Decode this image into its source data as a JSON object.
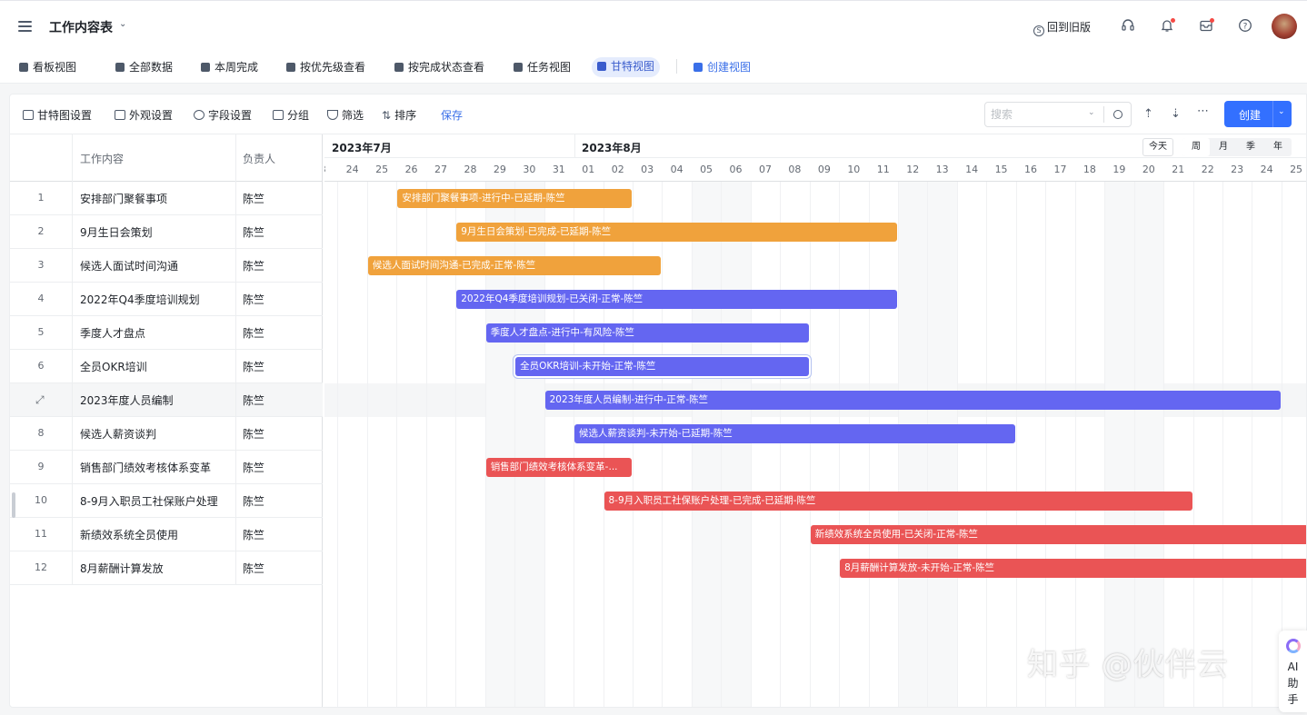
{
  "app": {
    "title": "工作内容表",
    "old_version": "回到旧版"
  },
  "views": [
    {
      "label": "看板视图"
    },
    {
      "label": "全部数据"
    },
    {
      "label": "本周完成"
    },
    {
      "label": "按优先级查看"
    },
    {
      "label": "按完成状态查看"
    },
    {
      "label": "任务视图"
    },
    {
      "label": "甘特视图",
      "active": true
    },
    {
      "label": "创建视图"
    }
  ],
  "toolbar": {
    "gantt_settings": "甘特图设置",
    "appearance": "外观设置",
    "fields": "字段设置",
    "group": "分组",
    "filter": "筛选",
    "sort": "排序",
    "save": "保存",
    "search_placeholder": "搜索",
    "create": "创建"
  },
  "table": {
    "col_task": "工作内容",
    "col_owner": "负责人",
    "rows": [
      {
        "no": "1",
        "task": "安排部门聚餐事项",
        "owner": "陈竺"
      },
      {
        "no": "2",
        "task": "9月生日会策划",
        "owner": "陈竺"
      },
      {
        "no": "3",
        "task": "候选人面试时间沟通",
        "owner": "陈竺"
      },
      {
        "no": "4",
        "task": "2022年Q4季度培训规划",
        "owner": "陈竺"
      },
      {
        "no": "5",
        "task": "季度人才盘点",
        "owner": "陈竺"
      },
      {
        "no": "6",
        "task": "全员OKR培训",
        "owner": "陈竺"
      },
      {
        "no": "",
        "task": "2023年度人员编制",
        "owner": "陈竺"
      },
      {
        "no": "8",
        "task": "候选人薪资谈判",
        "owner": "陈竺"
      },
      {
        "no": "9",
        "task": "销售部门绩效考核体系变革",
        "owner": "陈竺"
      },
      {
        "no": "10",
        "task": "8-9月入职员工社保账户处理",
        "owner": "陈竺"
      },
      {
        "no": "11",
        "task": "新绩效系统全员使用",
        "owner": "陈竺"
      },
      {
        "no": "12",
        "task": "8月薪酬计算发放",
        "owner": "陈竺"
      }
    ]
  },
  "gantt": {
    "months": [
      {
        "label": "2023年7月"
      },
      {
        "label": "2023年8月"
      }
    ],
    "days": [
      "3",
      "24",
      "25",
      "26",
      "27",
      "28",
      "29",
      "30",
      "31",
      "01",
      "02",
      "03",
      "04",
      "05",
      "06",
      "07",
      "08",
      "09",
      "10",
      "11",
      "12",
      "13",
      "14",
      "15",
      "16",
      "17",
      "18",
      "19",
      "20",
      "21",
      "22",
      "23",
      "24",
      "25"
    ],
    "today": "今天",
    "scales": [
      "周",
      "月",
      "季",
      "年"
    ],
    "active_scale": "周",
    "colors": {
      "orange": "#f0a23c",
      "purple": "#6466f1",
      "red": "#ea5455"
    },
    "bars": [
      {
        "label": "安排部门聚餐事项-进行中-已延期-陈竺",
        "start_day": "2023-07-25",
        "end_day": "2023-08-01",
        "color": "orange"
      },
      {
        "label": "9月生日会策划-已完成-已延期-陈竺",
        "start_day": "2023-07-27",
        "end_day": "2023-08-10",
        "color": "orange"
      },
      {
        "label": "候选人面试时间沟通-已完成-正常-陈竺",
        "start_day": "2023-07-24",
        "end_day": "2023-08-02",
        "color": "orange"
      },
      {
        "label": "2022年Q4季度培训规划-已关闭-正常-陈竺",
        "start_day": "2023-07-27",
        "end_day": "2023-08-10",
        "color": "purple"
      },
      {
        "label": "季度人才盘点-进行中-有风险-陈竺",
        "start_day": "2023-07-28",
        "end_day": "2023-08-07",
        "color": "purple"
      },
      {
        "label": "全员OKR培训-未开始-正常-陈竺",
        "start_day": "2023-07-29",
        "end_day": "2023-08-07",
        "color": "purple",
        "selected": true
      },
      {
        "label": "2023年度人员编制-进行中-正常-陈竺",
        "start_day": "2023-07-30",
        "end_day": "2023-08-23",
        "color": "purple"
      },
      {
        "label": "候选人薪资谈判-未开始-已延期-陈竺",
        "start_day": "2023-07-31",
        "end_day": "2023-08-14",
        "color": "purple"
      },
      {
        "label": "销售部门绩效考核体系变革-...",
        "start_day": "2023-07-28",
        "end_day": "2023-08-01",
        "color": "red"
      },
      {
        "label": "8-9月入职员工社保账户处理-已完成-已延期-陈竺",
        "start_day": "2023-08-01",
        "end_day": "2023-08-20",
        "color": "red"
      },
      {
        "label": "新绩效系统全员使用-已关闭-正常-陈竺",
        "start_day": "2023-08-08",
        "end_day": "2023-08-25",
        "color": "red"
      },
      {
        "label": "8月薪酬计算发放-未开始-正常-陈竺",
        "start_day": "2023-08-09",
        "end_day": "2023-08-25",
        "color": "red"
      }
    ]
  },
  "watermark": "知乎 @伙伴云",
  "ai_helper": [
    "AI",
    "助",
    "手"
  ]
}
